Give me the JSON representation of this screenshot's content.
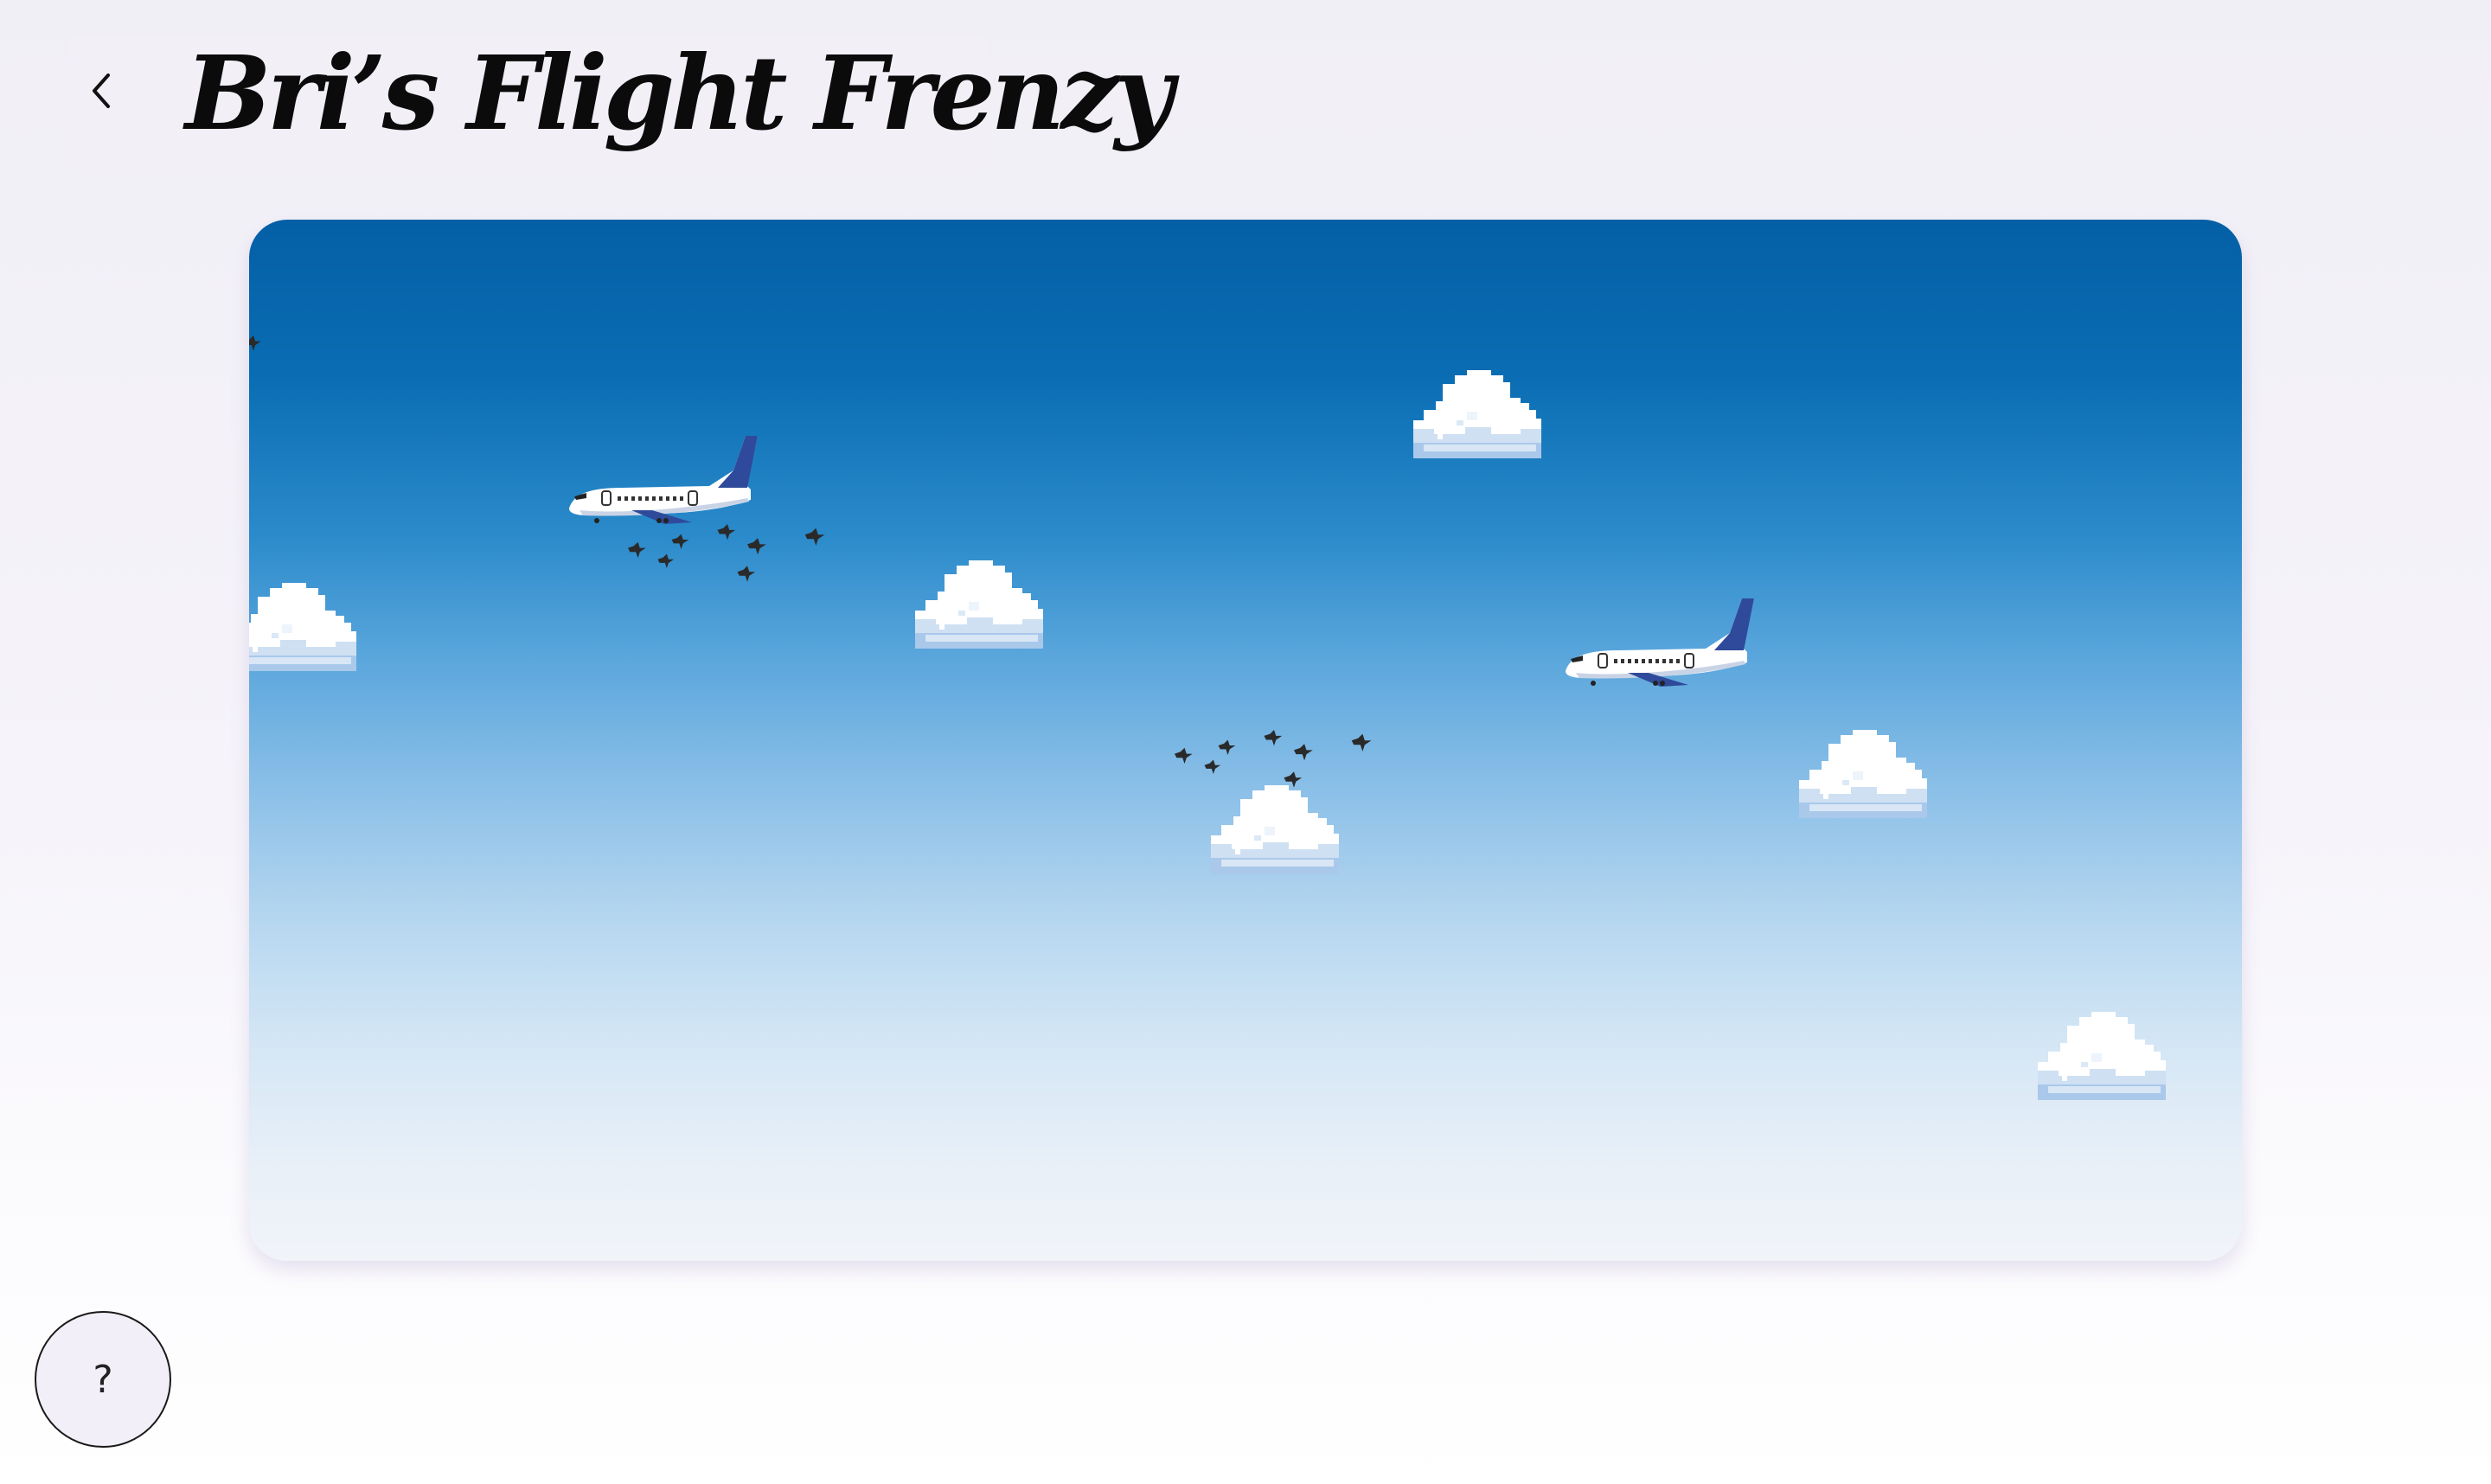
{
  "header": {
    "title": "Bri’s Flight Frenzy",
    "back_icon": "chevron-left-icon"
  },
  "game": {
    "sprites": {
      "plane": "airplane-icon",
      "cloud": "cloud-icon",
      "bird_flock": "bird-flock-icon"
    },
    "colors": {
      "sky_top": "#045fa6",
      "sky_bottom": "#f1f4f9",
      "plane_tail": "#2f4a9a",
      "bird": "#2a2a2a"
    }
  },
  "help": {
    "label": "?"
  }
}
